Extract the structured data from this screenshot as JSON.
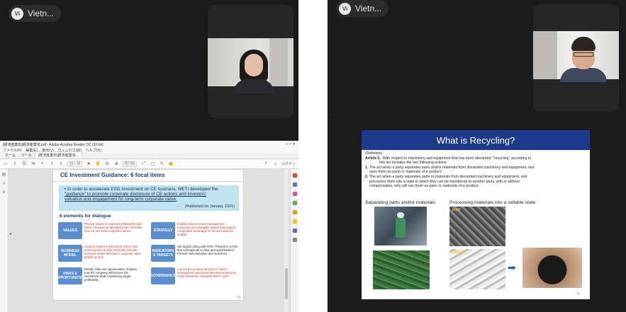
{
  "meeting": {
    "left_participant": {
      "label": "Vietn...",
      "initials": "Vi"
    },
    "right_participant": {
      "label": "Vietn...",
      "initials": "Vi"
    }
  },
  "acrobat": {
    "window_title": "[経済産業省]経済産業省.pdf - Adobe Acrobat Reader DC (32-bit)",
    "menu": [
      "ファイル(F)",
      "編集(E)",
      "表示(V)",
      "ウィンドウ(W)",
      "ヘルプ(H)"
    ],
    "tabs": [
      "ホーム",
      "ツール",
      "[経済産業省]経済産業省..."
    ],
    "toolbar": {
      "page": "16 / 16",
      "zoom": "87.1%",
      "share": "ログイン"
    },
    "slide": {
      "title": "CE Investment Guidance: 6 focal items",
      "banner_plain": "In order to accelerate ESG investment on CE business, METI developed the",
      "banner_link_1": "\"guidance\" to promote corporate disclosure of CE actions and investors'",
      "banner_link_2": "valuation and engagement for long-term corporate value.",
      "published": "(Published on January 2021)",
      "subtitle": "6 elements for dialogue",
      "elements": [
        {
          "box": "VALUES",
          "text": "Present values in corporate philosophy and vision / Reason for identifying CE / Describe how CE will make corporate values",
          "color": "red"
        },
        {
          "box": "STRATEGY",
          "text": "Explain how to secure management resources and intangible assets that support competitive advantage of circular business models",
          "color": "red"
        },
        {
          "box": "BUSINESS MODEL",
          "text": "Analyze market environment and its mid- and long-term trends / Describe how the business model will lead to corporate value growth as well",
          "color": "red"
        },
        {
          "box": "INDICATORS & TARGETS",
          "text": "Set targets along with KPIs / Present in a form that corresponds to risks and opportunities / Present self-evaluation and outcomes",
          "color": "black"
        },
        {
          "box": "RISKS & OPPORTUNITIES",
          "text": "Identify risks and opportunities / Explain how the company will recover the investment while maintaining target profitability",
          "color": "black"
        },
        {
          "box": "GOVERNANCE",
          "text": "Lay out governance structure in which management and board directors proactively make decisions / Establish PDCA cycle",
          "color": "red"
        }
      ],
      "page_number": "12"
    }
  },
  "recycling_slide": {
    "title": "What is Recycling?",
    "definition": "(Definition)",
    "article": "Article 2.",
    "article_text": "With respect to machinery and equipment that has been discarded, \"recycling\" according to",
    "article_text_2": "this act includes the two following actions.",
    "item1_num": "1.",
    "item1": "The act when a party separates parts and/or materials from discarded machinery and equipment, and",
    "item1b": "uses them as parts or materials of a product.",
    "item2_num": "2.",
    "item2": "The act when a party separates parts or materials from discarded machinery and equipment, and",
    "item2b": "processes them into a state in which they can be transferred to another party, with or without",
    "item2c": "compensation, who will use them as parts or materials of a product.",
    "head_left": "Separating parts and/or materials",
    "head_right": "Processing materials into a sellable state",
    "label_iron": "Iron",
    "label_plastic": "Plastic",
    "page_number": "12"
  }
}
